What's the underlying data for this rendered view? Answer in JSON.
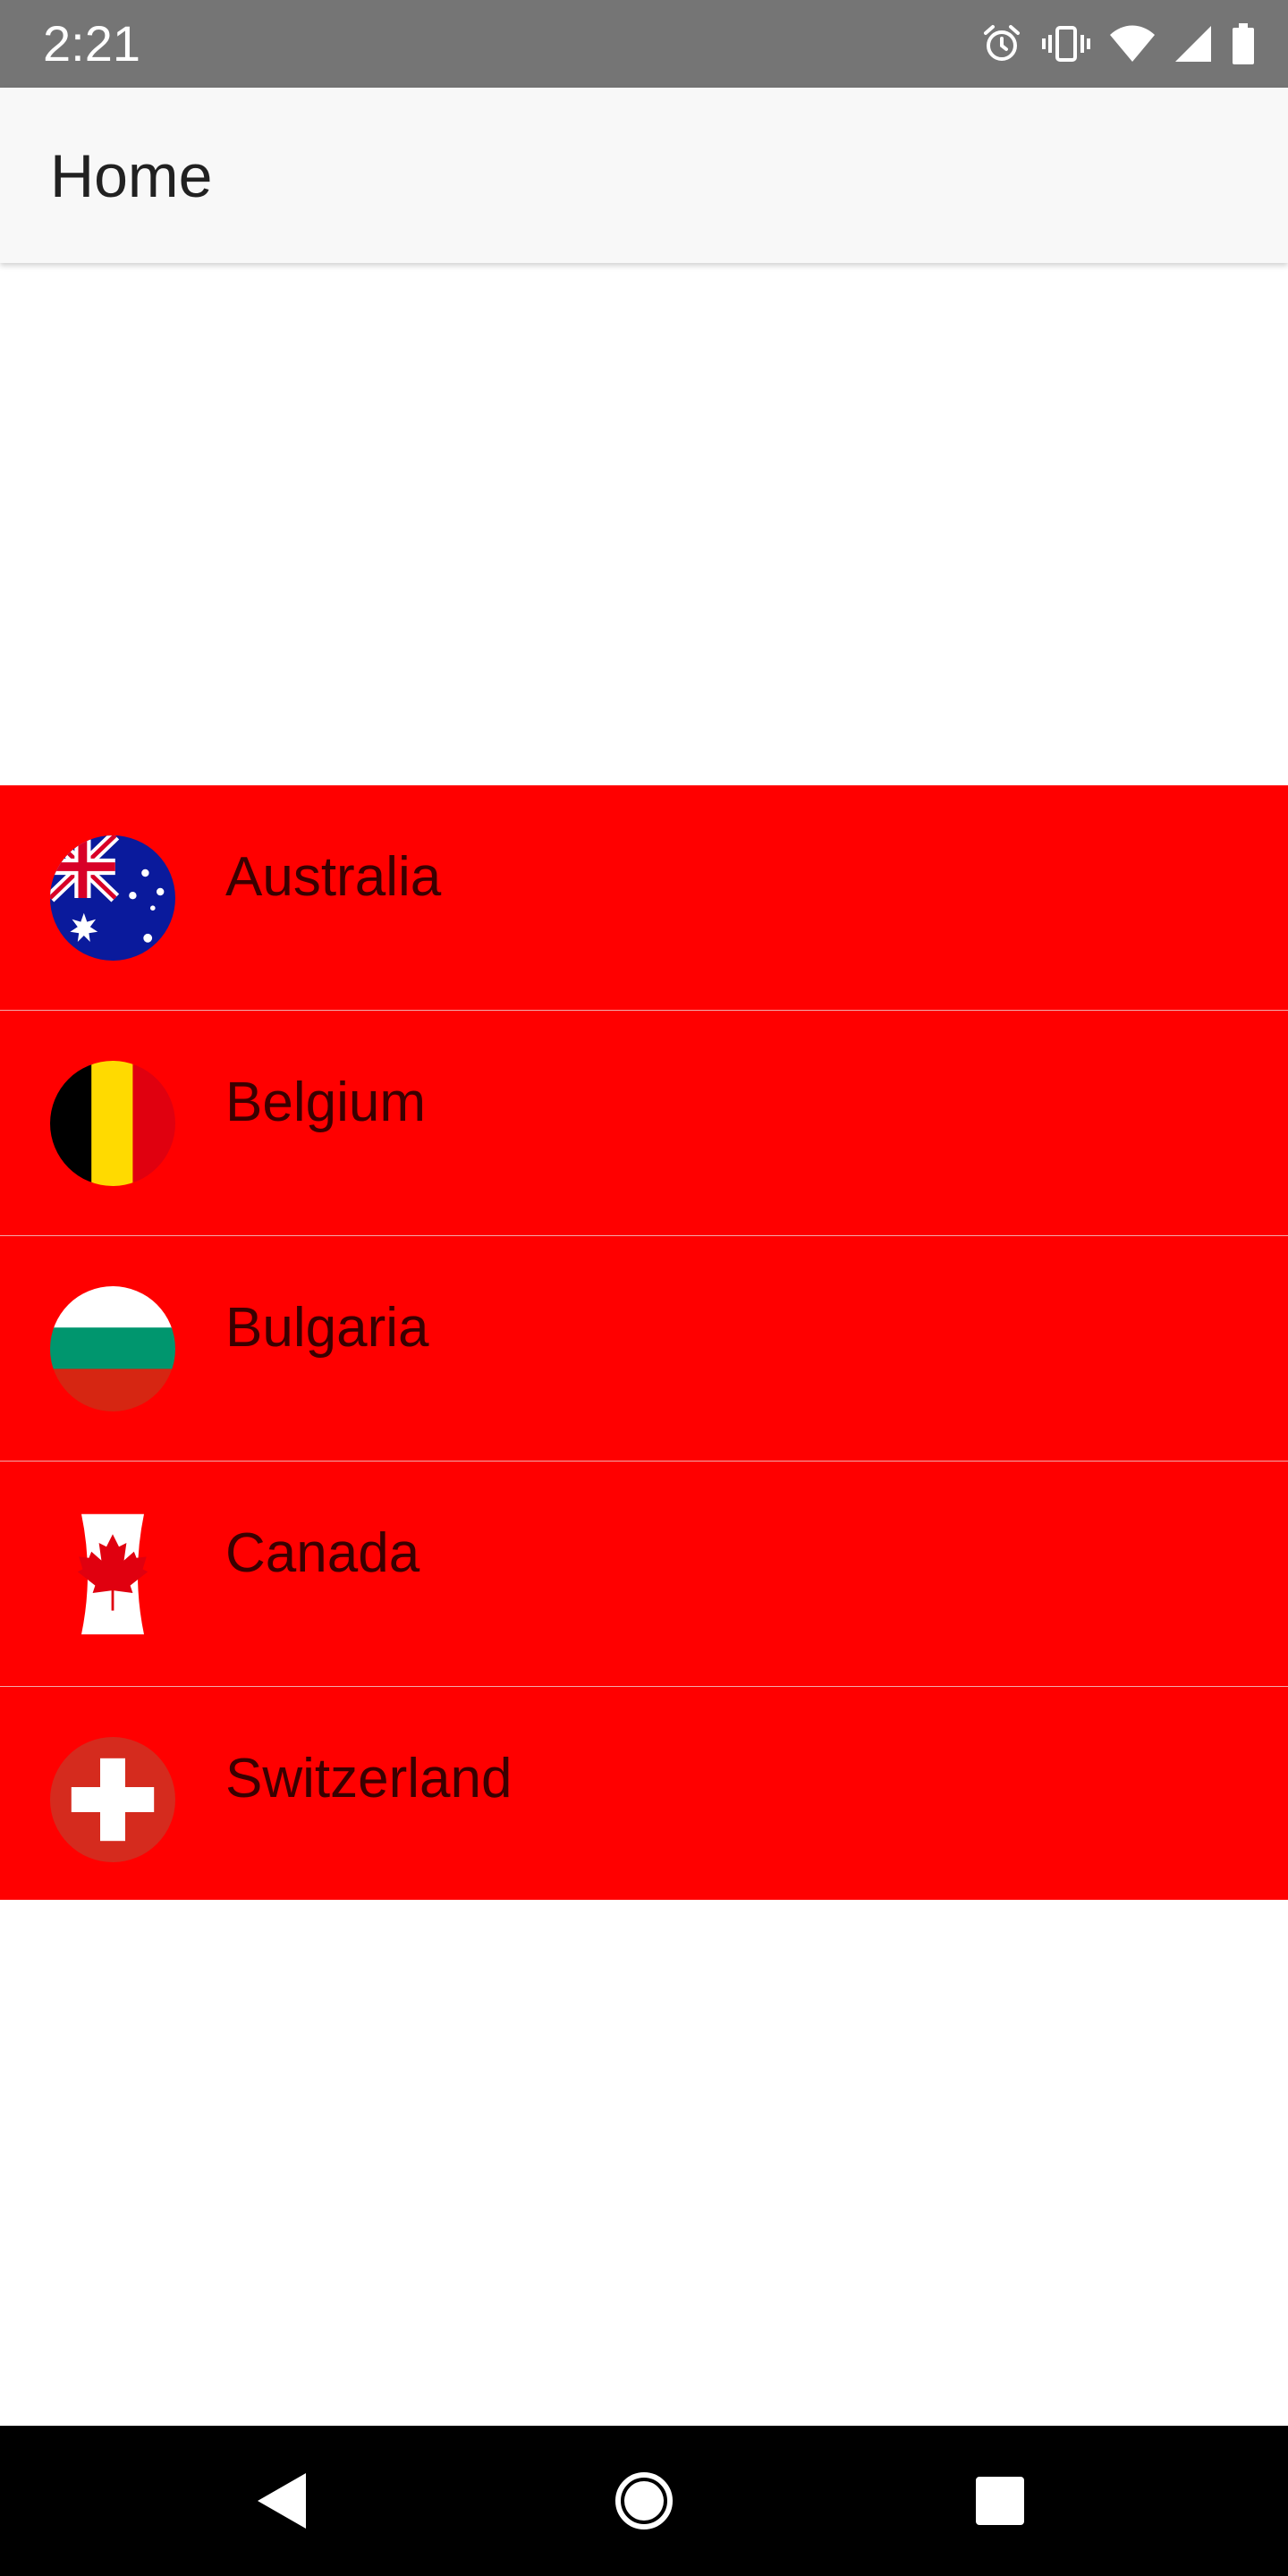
{
  "status_bar": {
    "time": "2:21",
    "icons": [
      "alarm-icon",
      "vibrate-icon",
      "wifi-icon",
      "signal-icon",
      "battery-icon"
    ]
  },
  "app_bar": {
    "title": "Home"
  },
  "countries": [
    {
      "name": "Australia",
      "flag": "australia-flag-icon"
    },
    {
      "name": "Belgium",
      "flag": "belgium-flag-icon"
    },
    {
      "name": "Bulgaria",
      "flag": "bulgaria-flag-icon"
    },
    {
      "name": "Canada",
      "flag": "canada-flag-icon"
    },
    {
      "name": "Switzerland",
      "flag": "switzerland-flag-icon"
    }
  ],
  "nav_bar": {
    "buttons": [
      "back-icon",
      "home-icon",
      "recents-icon"
    ]
  },
  "colors": {
    "status_bar": "#757575",
    "app_bar": "#f8f8f8",
    "list_item_background": "#ff0000",
    "nav_bar": "#000000"
  }
}
